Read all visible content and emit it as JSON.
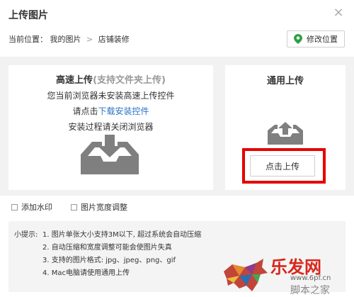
{
  "dialog": {
    "title": "上传图片",
    "close_glyph": "×"
  },
  "breadcrumb": {
    "prefix": "当前位置：",
    "item1": "我的图片",
    "separator": ">",
    "item2": "店铺装修"
  },
  "location_button": {
    "label": "修改位置",
    "icon": "map-pin-icon",
    "icon_color": "#2ea043"
  },
  "fast_upload": {
    "title": "高速上传",
    "title_hint": "(支持文件夹上传)",
    "line1": "您当前浏览器未安装高速上传控件",
    "line2_prefix": "请点击",
    "line2_link": "下载安装控件",
    "line3": "安装过程请关闭浏览器",
    "icon": "inbox-download-icon"
  },
  "general_upload": {
    "title": "通用上传",
    "icon": "upload-tray-icon",
    "button_label": "点击上传",
    "highlight_color": "#e60000"
  },
  "options": [
    {
      "label": "添加水印",
      "checked": false
    },
    {
      "label": "图片宽度调整",
      "checked": false
    }
  ],
  "tips": {
    "label": "小提示:",
    "items": [
      "1. 图片单张大小支持3M以下, 超过系统会自动压缩",
      "2. 自动压缩和宽度调整可能会使图片失真",
      "3. 支持的图片格式: jpg、jpeg、png、gif",
      "4. Mac电脑请使用通用上传"
    ]
  },
  "watermark": {
    "text1": "乐发网",
    "text2": "www.6pf.cn",
    "text3": "脚本之家"
  }
}
